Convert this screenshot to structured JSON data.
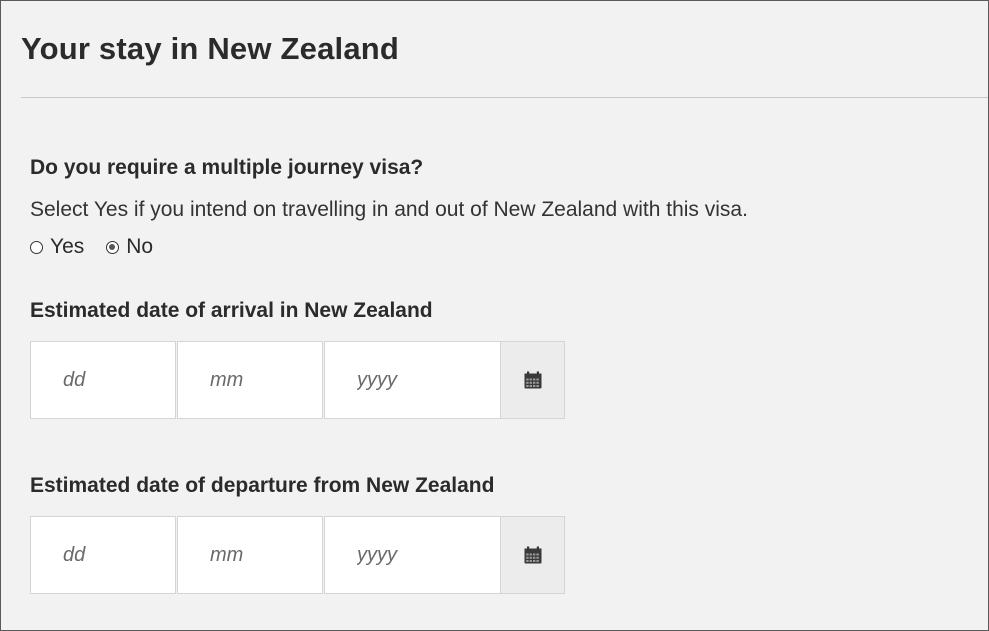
{
  "section": {
    "title": "Your stay in New Zealand"
  },
  "multiple_journey": {
    "question": "Do you require a multiple journey visa?",
    "hint": "Select Yes if you intend on travelling in and out of New Zealand with this visa.",
    "options": [
      {
        "label": "Yes",
        "selected": false
      },
      {
        "label": "No",
        "selected": true
      }
    ]
  },
  "arrival": {
    "label": "Estimated date of arrival in New Zealand",
    "day_placeholder": "dd",
    "month_placeholder": "mm",
    "year_placeholder": "yyyy",
    "calendar_icon": "calendar-icon"
  },
  "departure": {
    "label": "Estimated date of departure from New Zealand",
    "day_placeholder": "dd",
    "month_placeholder": "mm",
    "year_placeholder": "yyyy",
    "calendar_icon": "calendar-icon"
  }
}
